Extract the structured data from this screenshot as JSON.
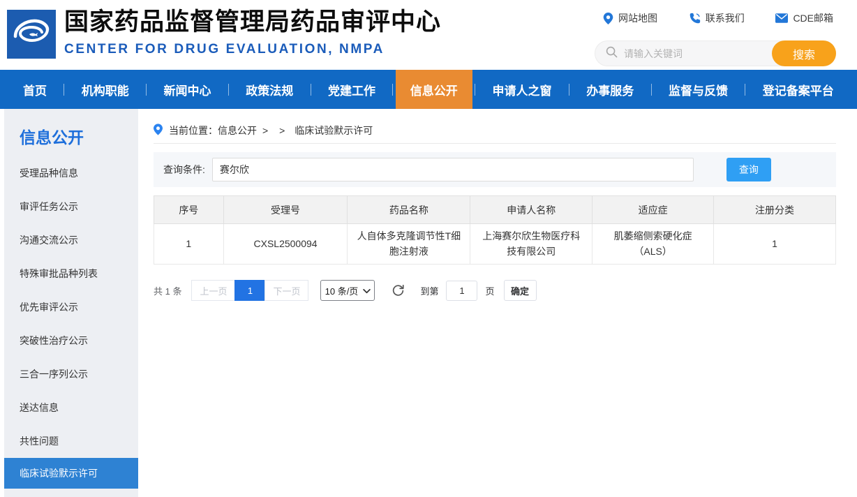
{
  "header": {
    "title": "国家药品监督管理局药品审评中心",
    "subtitle": "CENTER FOR DRUG EVALUATION, NMPA",
    "links": [
      {
        "label": "网站地图",
        "icon": "map-pin-icon"
      },
      {
        "label": "联系我们",
        "icon": "phone-icon"
      },
      {
        "label": "CDE邮箱",
        "icon": "mail-icon"
      }
    ],
    "search": {
      "placeholder": "请输入关键词",
      "button_label": "搜索"
    }
  },
  "nav": {
    "items": [
      {
        "label": "首页",
        "active": false
      },
      {
        "label": "机构职能",
        "active": false
      },
      {
        "label": "新闻中心",
        "active": false
      },
      {
        "label": "政策法规",
        "active": false
      },
      {
        "label": "党建工作",
        "active": false
      },
      {
        "label": "信息公开",
        "active": true
      },
      {
        "label": "申请人之窗",
        "active": false
      },
      {
        "label": "办事服务",
        "active": false
      },
      {
        "label": "监督与反馈",
        "active": false
      },
      {
        "label": "登记备案平台",
        "active": false
      }
    ]
  },
  "sidebar": {
    "title": "信息公开",
    "items": [
      {
        "label": "受理品种信息",
        "active": false
      },
      {
        "label": "审评任务公示",
        "active": false
      },
      {
        "label": "沟通交流公示",
        "active": false
      },
      {
        "label": "特殊审批品种列表",
        "active": false
      },
      {
        "label": "优先审评公示",
        "active": false
      },
      {
        "label": "突破性治疗公示",
        "active": false
      },
      {
        "label": "三合一序列公示",
        "active": false
      },
      {
        "label": "送达信息",
        "active": false
      },
      {
        "label": "共性问题",
        "active": false
      },
      {
        "label": "临床试验默示许可",
        "active": true
      }
    ]
  },
  "breadcrumb": {
    "prefix": "当前位置：",
    "section": "信息公开",
    "separator": "> >",
    "current": "临床试验默示许可"
  },
  "query": {
    "label": "查询条件:",
    "value": "赛尔欣",
    "button_label": "查询"
  },
  "table": {
    "headers": [
      "序号",
      "受理号",
      "药品名称",
      "申请人名称",
      "适应症",
      "注册分类"
    ],
    "rows": [
      [
        "1",
        "CXSL2500094",
        "人自体多克隆调节性T细胞注射液",
        "上海赛尔欣生物医疗科技有限公司",
        "肌萎缩侧索硬化症（ALS）",
        "1"
      ]
    ]
  },
  "pagination": {
    "total": "共 1 条",
    "prev_label": "上一页",
    "current_page": "1",
    "next_label": "下一页",
    "page_size": "10 条/页",
    "goto_prefix": "到第",
    "goto_value": "1",
    "goto_suffix": "页",
    "confirm_label": "确定"
  },
  "colors": {
    "nav_blue": "#1169c4",
    "active_tab_orange": "#e98b32",
    "search_button_orange": "#f8a21b",
    "subtitle_blue": "#1b5cba",
    "sidebar_title_blue": "#1e6fdb",
    "sidebar_active_blue": "#2e82d3",
    "query_button_blue": "#2f9ff4",
    "pagination_active_blue": "#2273e3",
    "link_icon_blue": "#2277d8"
  }
}
